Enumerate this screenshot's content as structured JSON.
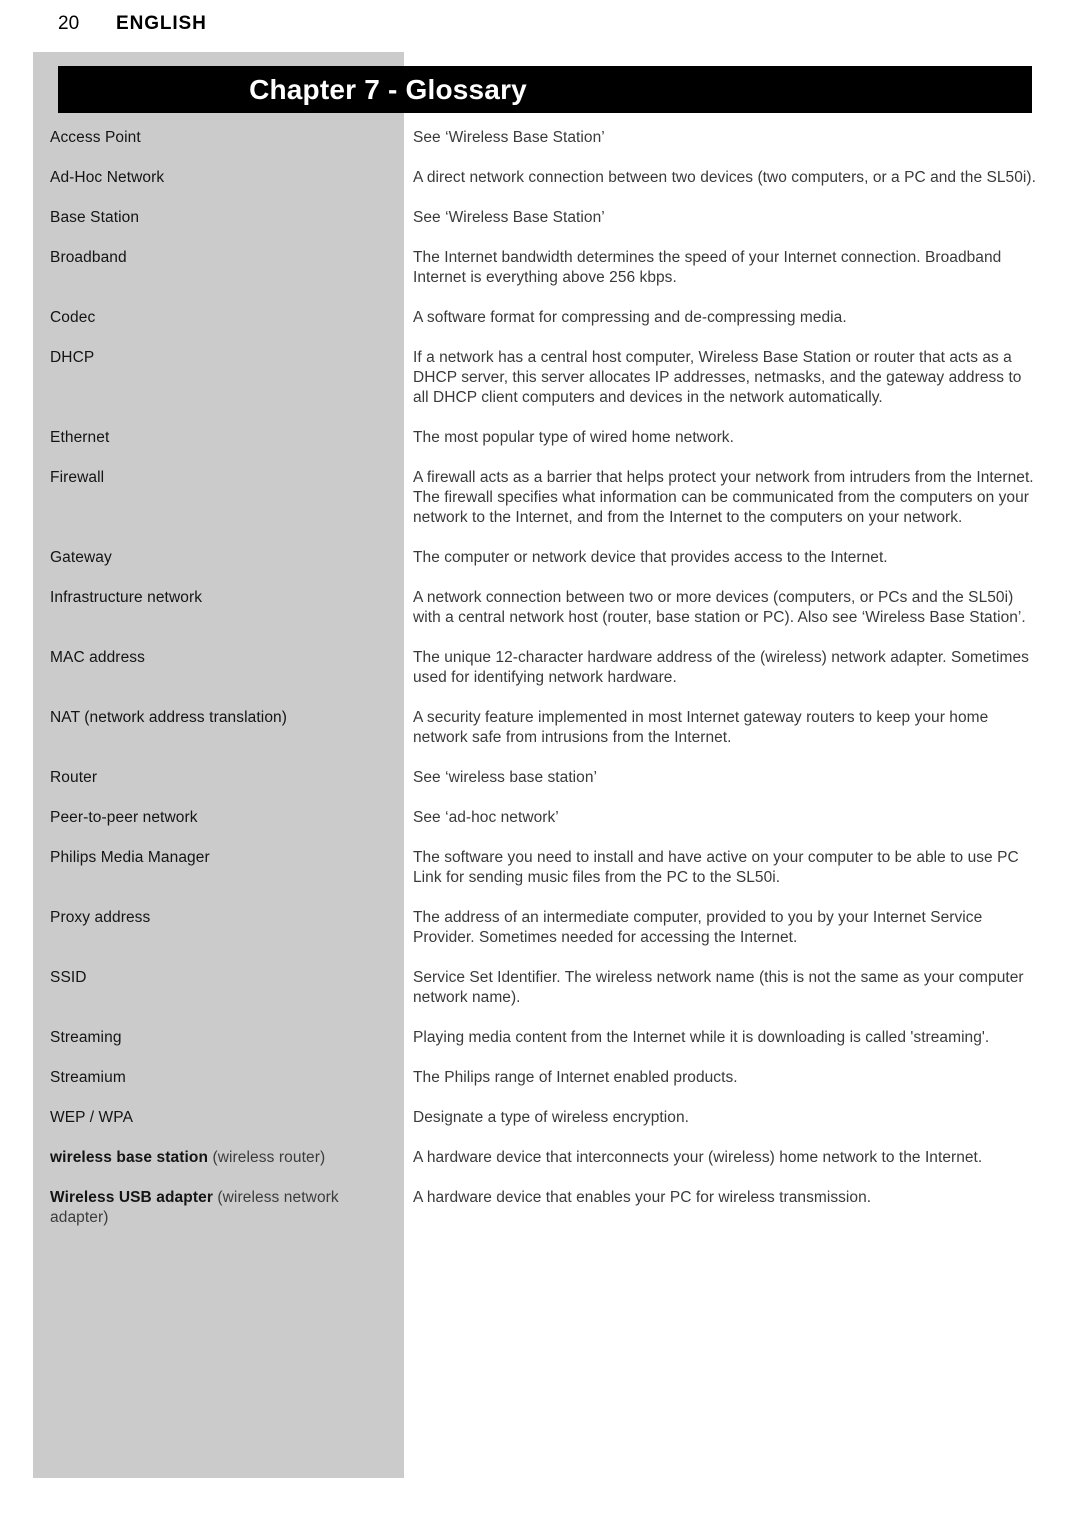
{
  "running_head": {
    "page_number": "20",
    "section": "ENGLISH"
  },
  "chapter": {
    "title": "Chapter 7 - Glossary"
  },
  "glossary": {
    "entries": [
      {
        "term": "Access Point",
        "term_bold": false,
        "definition": "See ‘Wireless Base Station’"
      },
      {
        "term": "Ad-Hoc Network",
        "term_bold": false,
        "definition": "A direct network connection between two devices (two computers, or a PC and the SL50i)."
      },
      {
        "term": "Base Station",
        "term_bold": false,
        "definition": "See ‘Wireless Base Station’"
      },
      {
        "term": "Broadband",
        "term_bold": false,
        "definition": "The Internet bandwidth determines the speed of your Internet connection. Broadband Internet is everything above 256 kbps."
      },
      {
        "term": "Codec",
        "term_bold": false,
        "definition": "A software format for compressing and de-compressing media."
      },
      {
        "term": "DHCP",
        "term_bold": false,
        "definition": "If a network has a central host computer, Wireless Base Station or router that acts as a DHCP server, this server allocates IP addresses, netmasks, and the gateway address to all DHCP client computers and devices in the network automatically."
      },
      {
        "term": "Ethernet",
        "term_bold": false,
        "definition": "The most popular type of wired home network."
      },
      {
        "term": "Firewall",
        "term_bold": false,
        "definition": "A firewall acts as a barrier that helps protect your network from intruders from the Internet. The firewall specifies what information can be communicated from the computers on your network to the Internet, and from the Internet to the computers on your network."
      },
      {
        "term": "Gateway",
        "term_bold": false,
        "definition": "The computer or network device that provides access to the Internet."
      },
      {
        "term": "Infrastructure network",
        "term_bold": false,
        "definition": "A network connection between two or more devices (computers, or PCs and the SL50i) with a central network host (router, base station or PC). Also see ‘Wireless Base Station’."
      },
      {
        "term": "MAC address",
        "term_bold": false,
        "definition": "The unique 12-character hardware address of the (wireless) network adapter. Sometimes used for identifying network hardware."
      },
      {
        "term": "NAT (network address translation)",
        "term_bold": false,
        "definition": "A security feature implemented in most Internet gateway routers to keep your home network safe from intrusions from the Internet."
      },
      {
        "term": "Router",
        "term_bold": false,
        "definition": "See ‘wireless base station’"
      },
      {
        "term": "Peer-to-peer network",
        "term_bold": false,
        "definition": "See ‘ad-hoc network’"
      },
      {
        "term": "Philips Media Manager",
        "term_bold": false,
        "definition": "The software you need to install and have active on your computer to be able to use PC Link for sending music files from the PC to the SL50i."
      },
      {
        "term": "Proxy address",
        "term_bold": false,
        "definition": "The address of an intermediate computer, provided to you by your Internet Service Provider. Sometimes needed for accessing the Internet."
      },
      {
        "term": "SSID",
        "term_bold": false,
        "definition": "Service Set Identifier. The wireless network name (this is not the same as your computer network name)."
      },
      {
        "term": "Streaming",
        "term_bold": false,
        "definition": "Playing media content from the Internet while it is downloading is called 'streaming'."
      },
      {
        "term": "Streamium",
        "term_bold": false,
        "definition": "The Philips range of Internet enabled products."
      },
      {
        "term": "WEP / WPA",
        "term_bold": false,
        "definition": "Designate a type of wireless encryption."
      },
      {
        "term": "wireless base station",
        "term_suffix": " (wireless router)",
        "term_bold": true,
        "definition": "A hardware device that interconnects your (wireless) home network to the Internet."
      },
      {
        "term": "Wireless USB adapter",
        "term_suffix": " (wireless network adapter)",
        "term_bold": true,
        "definition": "A hardware device that enables your PC for wireless transmission."
      }
    ]
  },
  "colors": {
    "panel_gray": "#cbcbcb",
    "banner_black": "#000000",
    "banner_text": "#ffffff",
    "term_text": "#141414",
    "definition_text": "#3a3a3a",
    "page_background": "#ffffff"
  }
}
